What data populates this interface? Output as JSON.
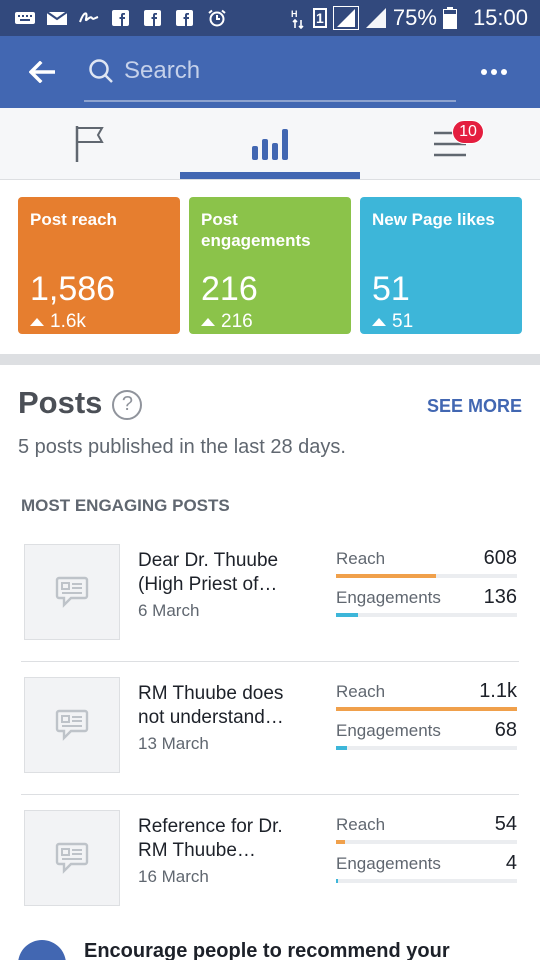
{
  "status_bar": {
    "battery": "75%",
    "time": "15:00",
    "sim": "1"
  },
  "header": {
    "search_placeholder": "Search"
  },
  "tabs": [
    {
      "name": "flag",
      "icon": "flag-icon"
    },
    {
      "name": "insights",
      "icon": "bar-chart-icon",
      "active": true
    },
    {
      "name": "menu",
      "icon": "menu-icon",
      "badge": "10"
    }
  ],
  "stats": [
    {
      "title": "Post reach",
      "value": "1,586",
      "change": "1.6k",
      "color": "#e67e2f"
    },
    {
      "title": "Post engagements",
      "value": "216",
      "change": "216",
      "color": "#8bc34a"
    },
    {
      "title": "New Page likes",
      "value": "51",
      "change": "51",
      "color": "#3db6d9"
    }
  ],
  "posts": {
    "title": "Posts",
    "see_more": "SEE MORE",
    "description": "5 posts published in the last 28 days.",
    "section_label": "MOST ENGAGING POSTS",
    "items": [
      {
        "title": "Dear Dr. Thuube (High Priest of…",
        "date": "6 March",
        "reach_label": "Reach",
        "reach": "608",
        "reach_fraction": 0.55,
        "engagements_label": "Engagements",
        "engagements": "136",
        "engagements_fraction": 0.12
      },
      {
        "title": "RM Thuube does not understand…",
        "date": "13 March",
        "reach_label": "Reach",
        "reach": "1.1k",
        "reach_fraction": 1.0,
        "engagements_label": "Engagements",
        "engagements": "68",
        "engagements_fraction": 0.06
      },
      {
        "title": "Reference for Dr. RM Thuube…",
        "date": "16 March",
        "reach_label": "Reach",
        "reach": "54",
        "reach_fraction": 0.05,
        "engagements_label": "Engagements",
        "engagements": "4",
        "engagements_fraction": 0.01
      }
    ]
  },
  "footer_prompt": "Encourage people to recommend your",
  "colors": {
    "reach_bar": "#f0a04b",
    "engagement_bar": "#3db6d9",
    "accent": "#4267b2"
  }
}
